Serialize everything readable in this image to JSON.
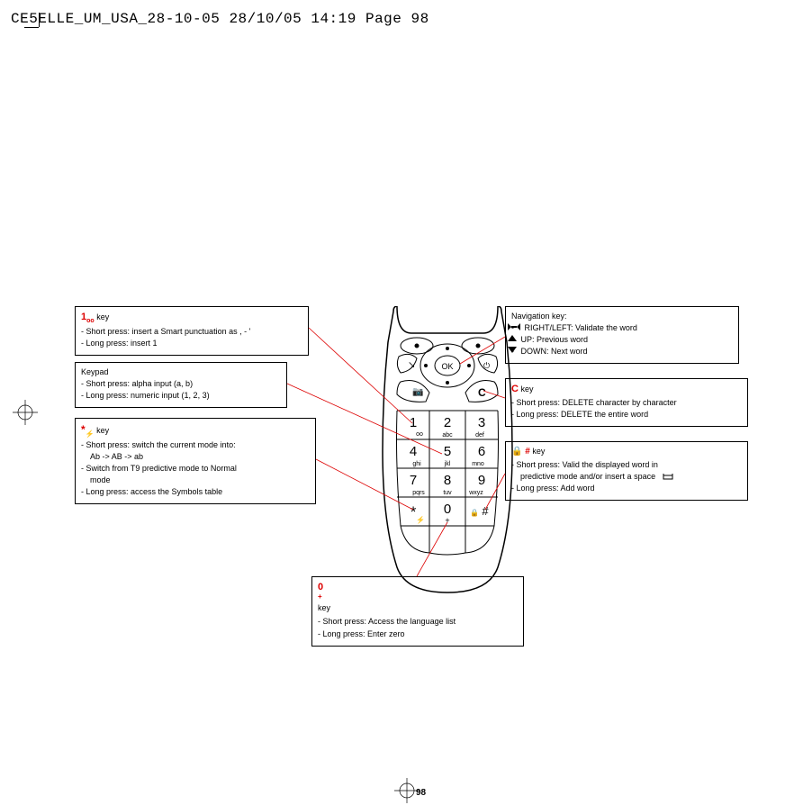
{
  "print_header": "CE5ELLE_UM_USA_28-10-05  28/10/05  14:19  Page 98",
  "page_number": "98",
  "box_1key": {
    "title_suffix": "key",
    "icon": "1",
    "icon_sub": "∞",
    "items": [
      "Short press: insert a Smart punctuation as , - '",
      "Long press: insert 1"
    ]
  },
  "box_keypad": {
    "title": "Keypad",
    "items": [
      "Short press: alpha input (a, b)",
      "Long press: numeric input (1, 2, 3)"
    ]
  },
  "box_star": {
    "title_suffix": "key",
    "icon": "*",
    "items": [
      "Short press: switch the current mode into: Ab -> AB -> ab",
      "Switch from T9 predictive mode to Normal mode",
      "Long press: access the Symbols table"
    ]
  },
  "box_nav": {
    "title": "Navigation key:",
    "items": [
      "RIGHT/LEFT: Validate the word",
      "UP: Previous word",
      "DOWN: Next word"
    ]
  },
  "box_c": {
    "title_suffix": "key",
    "icon": "C",
    "items": [
      "Short press: DELETE character by character",
      "Long press: DELETE the entire word"
    ]
  },
  "box_hash": {
    "title_suffix": "key",
    "icon": "#",
    "items": [
      "Short press: Valid the displayed word in predictive mode and/or insert a space",
      "Long press: Add word"
    ]
  },
  "box_zero": {
    "title_suffix": "key",
    "icon": "0",
    "icon_sub": "+",
    "items": [
      "Short press: Access the language list",
      "Long press: Enter zero"
    ]
  },
  "keypad": {
    "1": {
      "num": "1",
      "sub": ""
    },
    "2": {
      "num": "2",
      "sub": "abc"
    },
    "3": {
      "num": "3",
      "sub": "def"
    },
    "4": {
      "num": "4",
      "sub": "ghi"
    },
    "5": {
      "num": "5",
      "sub": "jkl"
    },
    "6": {
      "num": "6",
      "sub": "mno"
    },
    "7": {
      "num": "7",
      "sub": "pqrs"
    },
    "8": {
      "num": "8",
      "sub": "tuv"
    },
    "9": {
      "num": "9",
      "sub": "wxyz"
    },
    "0": {
      "num": "0",
      "sub": "+"
    },
    "star": "*",
    "hash": "#"
  }
}
